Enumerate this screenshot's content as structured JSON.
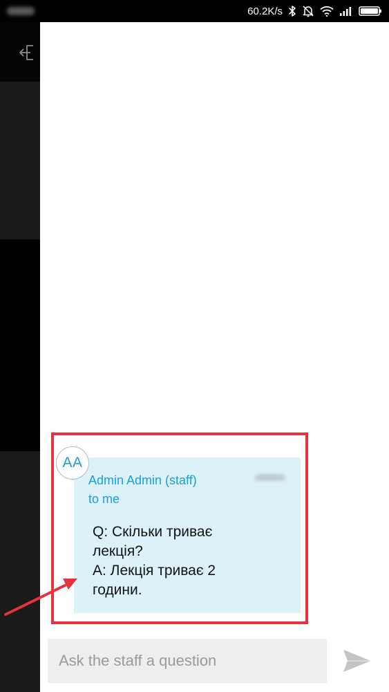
{
  "status_bar": {
    "network_speed": "60.2K/s",
    "icons": [
      "bluetooth-icon",
      "alarm-off-icon",
      "wifi-icon",
      "signal-icon",
      "battery-icon"
    ]
  },
  "background_app": {
    "icons": [
      "logout-icon"
    ]
  },
  "message": {
    "avatar_initials": "AA",
    "sender": "Admin Admin (staff)",
    "recipient": "to me",
    "body_lines": [
      "Q: Скільки триває",
      "лекція?",
      "A: Лекція триває 2",
      "години."
    ]
  },
  "composer": {
    "placeholder": "Ask the staff a question",
    "send_icon": "send-icon"
  },
  "colors": {
    "accent": "#18a0dc",
    "message_bg": "#dcf2f8",
    "annotation": "#e8323c"
  }
}
